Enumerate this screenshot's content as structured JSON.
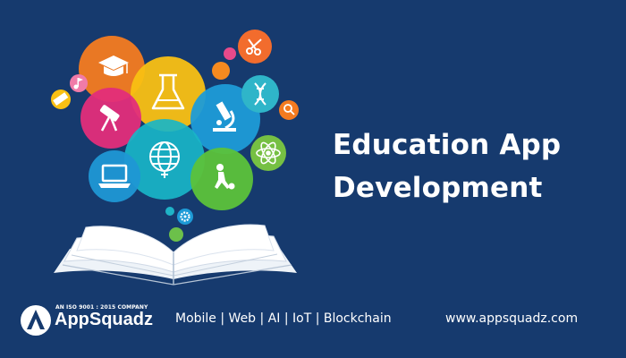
{
  "headline": {
    "line1": "Education App",
    "line2": "Development"
  },
  "brand": {
    "tagline": "AN ISO 9001 : 2015 COMPANY",
    "name": "AppSquadz"
  },
  "footer": {
    "services": "Mobile | Web | AI | IoT | Blockchain",
    "website": "www.appsquadz.com"
  },
  "colors": {
    "background": "#163a6e",
    "text": "#ffffff"
  },
  "icons": [
    "graduation-cap-icon",
    "flask-icon",
    "microscope-icon",
    "dna-icon",
    "globe-icon",
    "atom-icon",
    "laptop-icon",
    "scissors-icon",
    "music-note-icon",
    "ruler-icon",
    "magnifier-icon",
    "football-player-icon",
    "telescope-icon",
    "gear-icon",
    "open-book-icon"
  ]
}
